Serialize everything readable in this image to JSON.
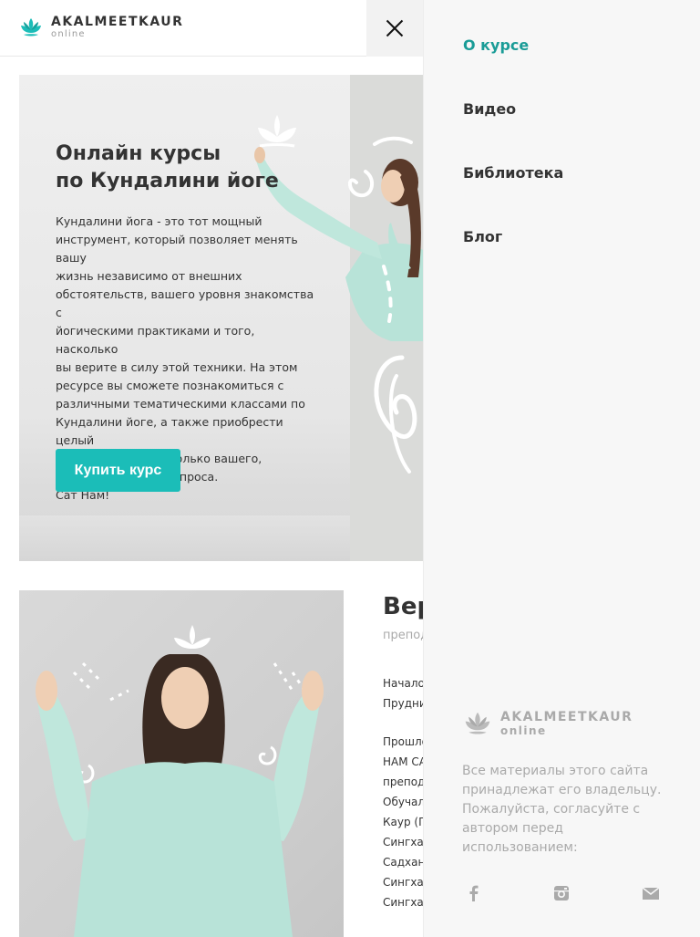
{
  "brand": {
    "name": "AKALMEETKAUR",
    "sub": "online",
    "color": "#1bbdb8"
  },
  "hero": {
    "title_line1": "Онлайн курсы",
    "title_line2": "по Кундалини йоге",
    "text": "Кундалини йога - это тот мощный\nинструмент, который позволяет менять вашу\nжизнь независимо от внешних\nобстоятельств, вашего уровня знакомства с\nйогическими практиками и того, насколько\nвы верите в силу этой техники.  На этом\nресурсе вы сможете познакомиться с\nразличными тематическими классами по\nКундалини йоге, а также приобрести целый\nкурс для решения только вашего,\nиндивидуального запроса.\nСат  Нам!",
    "button": "Купить курс"
  },
  "section2": {
    "title": "Вер",
    "subtitle": "препод",
    "lines": [
      "Начало",
      "Прудни",
      "",
      "Прошло",
      "НАМ СА",
      "препод",
      "Обучал",
      "Каур (Г",
      "Сингха",
      "Садхан",
      "Сингха",
      "Сингха"
    ]
  },
  "menu": {
    "items": [
      {
        "label": "О курсе",
        "active": true
      },
      {
        "label": "Видео",
        "active": false
      },
      {
        "label": "Библиотека",
        "active": false
      },
      {
        "label": "Блог",
        "active": false
      }
    ],
    "note": "Все материалы этого сайта принадлежат его владельцу. Пожалуйста, согласуйте с автором перед использованием:",
    "social": [
      "facebook-icon",
      "instagram-icon",
      "mail-icon"
    ],
    "active_color": "#1a9c97"
  }
}
